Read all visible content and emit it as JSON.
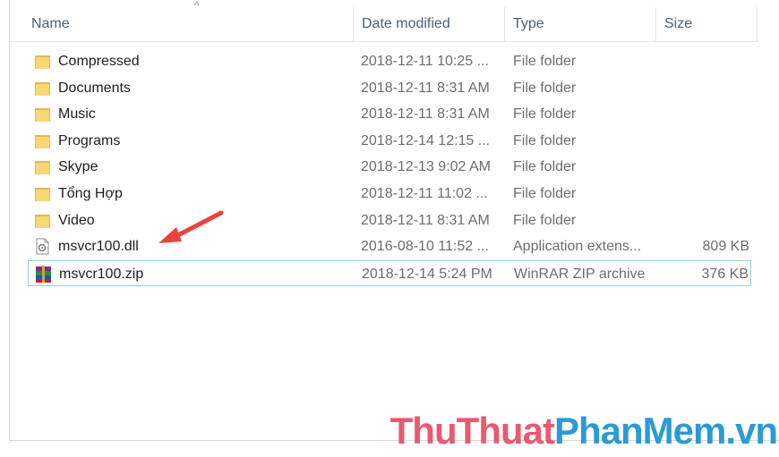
{
  "columns": {
    "name": "Name",
    "date": "Date modified",
    "type": "Type",
    "size": "Size",
    "sort_indicator": "^"
  },
  "files": [
    {
      "name": "Compressed",
      "date": "2018-12-11 10:25 ...",
      "type": "File folder",
      "size": "",
      "icon": "folder-icon"
    },
    {
      "name": "Documents",
      "date": "2018-12-11 8:31 AM",
      "type": "File folder",
      "size": "",
      "icon": "folder-icon"
    },
    {
      "name": "Music",
      "date": "2018-12-11 8:31 AM",
      "type": "File folder",
      "size": "",
      "icon": "folder-icon"
    },
    {
      "name": "Programs",
      "date": "2018-12-14 12:15 ...",
      "type": "File folder",
      "size": "",
      "icon": "folder-icon"
    },
    {
      "name": "Skype",
      "date": "2018-12-13 9:02 AM",
      "type": "File folder",
      "size": "",
      "icon": "folder-icon"
    },
    {
      "name": "Tổng Hợp",
      "date": "2018-12-11 11:02 ...",
      "type": "File folder",
      "size": "",
      "icon": "folder-icon"
    },
    {
      "name": "Video",
      "date": "2018-12-11 8:31 AM",
      "type": "File folder",
      "size": "",
      "icon": "folder-icon"
    },
    {
      "name": "msvcr100.dll",
      "date": "2016-08-10 11:52 ...",
      "type": "Application extens...",
      "size": "809 KB",
      "icon": "dll-file-icon"
    },
    {
      "name": "msvcr100.zip",
      "date": "2018-12-14 5:24 PM",
      "type": "WinRAR ZIP archive",
      "size": "376 KB",
      "icon": "winrar-archive-icon",
      "selected": true
    }
  ],
  "watermark": {
    "part1": "ThuThuat",
    "part2": "PhanMem",
    "part3": ".vn"
  },
  "colors": {
    "folder": "#f8d775",
    "folder_dark": "#e2b94c",
    "selection_border": "#99c9ef",
    "annotation_arrow": "#e8443a"
  }
}
